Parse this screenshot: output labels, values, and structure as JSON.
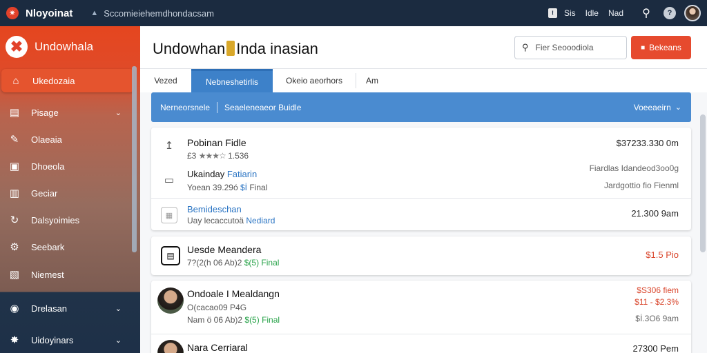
{
  "topbar": {
    "logo_glyph": "✴",
    "app_name": "Nloyoinat",
    "lock_glyph": "▲",
    "url": "Sccomieiehemdhondacsam",
    "badge": "!",
    "links": [
      "Sis",
      "Idle",
      "Nad"
    ],
    "search_glyph": "⚲",
    "help_glyph": "?"
  },
  "sidebar": {
    "logo_glyph": "✖",
    "title": "Undowhala",
    "items": [
      {
        "label": "Ukedozaia",
        "icon": "home-icon",
        "glyph": "⌂",
        "active": true
      },
      {
        "label": "Pisage",
        "icon": "layers-icon",
        "glyph": "▤",
        "chevron": true
      },
      {
        "label": "Olaeaia",
        "icon": "pen-icon",
        "glyph": "✎"
      },
      {
        "label": "Dhoeola",
        "icon": "briefcase-icon",
        "glyph": "▣"
      },
      {
        "label": "Geciar",
        "icon": "document-icon",
        "glyph": "▥"
      },
      {
        "label": "Dalsyoimies",
        "icon": "refresh-icon",
        "glyph": "↻"
      },
      {
        "label": "Seebark",
        "icon": "settings-icon",
        "glyph": "⚙"
      },
      {
        "label": "Niemest",
        "icon": "inbox-icon",
        "glyph": "▧"
      },
      {
        "label": "Drelasan",
        "icon": "globe-icon",
        "glyph": "◉",
        "chevron": true
      },
      {
        "label": "Uidoyinars",
        "icon": "gear-icon",
        "glyph": "✸",
        "chevron": true
      }
    ]
  },
  "page": {
    "title_left": "Undowhan",
    "title_right": "Inda inasian",
    "filter_placeholder": "Fier Seooodiola",
    "cta_label": "Bekeans",
    "cta_glyph": "■"
  },
  "tabs": [
    {
      "label": "Vezed"
    },
    {
      "label": "Nebneshetirlis",
      "active": true
    },
    {
      "label": "Okeio aeorhors"
    },
    {
      "label": "Am"
    }
  ],
  "filterbar": {
    "left": "Nerneorsnele",
    "mid": "Seaeleneaeor Buidle",
    "right": "Voeeaeirn"
  },
  "rows": [
    {
      "title": "Pobinan Fidle",
      "sub_prefix": "£3",
      "stars": "★★★☆",
      "sub_suffix": "1.536",
      "value": "$37233.330 0m"
    },
    {
      "title": "Ukainday",
      "title_blue": "Fatiarin",
      "sub_prefix": "Yoean 39.29ó ",
      "sub_green": "$İ",
      "sub_suffix": " Final",
      "value_top": "Fiardlas Idandeod3oo0g",
      "value_bottom": "Jardgottio fio Fienml"
    },
    {
      "title": "Bemideschan",
      "sub_prefix": "Uay lecaccutoä ",
      "sub_blue": "Nediard",
      "value": "21.300 9am"
    },
    {
      "title": "Uesde Meandera",
      "sub_prefix": "7?(2(h 06 Ab)2 ",
      "sub_green": "$(5) Final",
      "value": "$1.5 Pio"
    },
    {
      "title": "Ondoale I Mealdangn",
      "sub_prefix": "O(cacao09",
      "sub_mid": " P4G",
      "sub_line3": "Nam ö  06 Ab)2 ",
      "sub_green": "$(5) Final",
      "value_top": "$S306 fiem",
      "value_mid": "$11 - $2.3%",
      "value_bottom": "$İ.3O6 9am"
    },
    {
      "title": "Nara Cerriaral",
      "value": "27300 Pem"
    }
  ],
  "colors": {
    "topbar": "#1b2b40",
    "sidebar_accent": "#e5461f",
    "primary_blue": "#4a8bd0",
    "cta": "#e64a2e",
    "positive": "#29a34a",
    "negative": "#d9442a"
  }
}
